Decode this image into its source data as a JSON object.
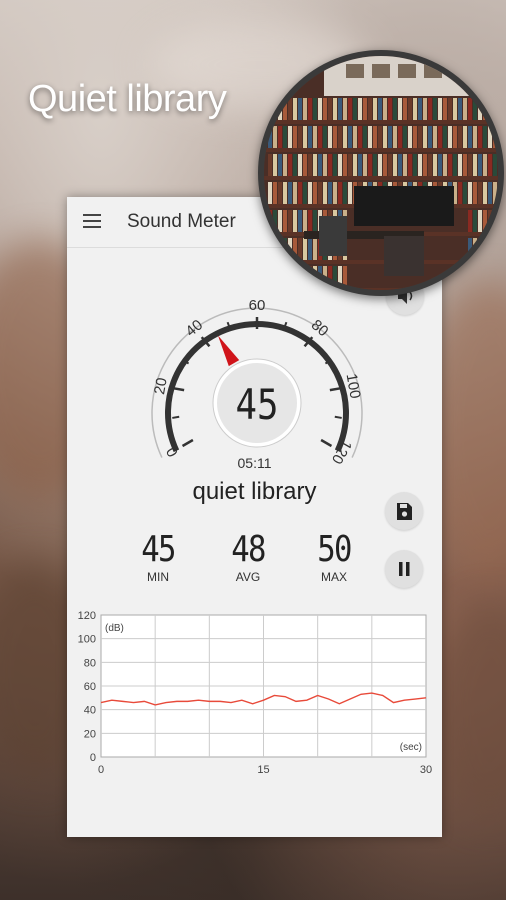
{
  "headline": "Quiet library",
  "app": {
    "title": "Sound Meter",
    "menu_icon": "hamburger-menu-icon"
  },
  "gauge": {
    "ticks": [
      "0",
      "20",
      "40",
      "60",
      "80",
      "100",
      "120"
    ],
    "reading": "45",
    "needle_db": 45,
    "needle_color": "#d0141a"
  },
  "timer": "05:11",
  "environment": "quiet library",
  "stats": {
    "min": {
      "value": "45",
      "label": "MIN"
    },
    "avg": {
      "value": "48",
      "label": "AVG"
    },
    "max": {
      "value": "50",
      "label": "MAX"
    }
  },
  "buttons": {
    "speaker_icon": "speaker-icon",
    "save_icon": "save-icon",
    "pause_icon": "pause-icon"
  },
  "chart_data": {
    "type": "line",
    "ylabel": "(dB)",
    "xlabel": "(sec)",
    "xlim": [
      0,
      30
    ],
    "ylim": [
      0,
      120
    ],
    "x_ticks": [
      "0",
      "15",
      "30"
    ],
    "y_ticks": [
      "0",
      "20",
      "40",
      "60",
      "80",
      "100",
      "120"
    ],
    "grid": true,
    "line_color": "#e84a3a",
    "x": [
      0,
      1,
      2,
      3,
      4,
      5,
      6,
      7,
      8,
      9,
      10,
      11,
      12,
      13,
      14,
      15,
      16,
      17,
      18,
      19,
      20,
      21,
      22,
      23,
      24,
      25,
      26,
      27,
      28,
      29,
      30
    ],
    "values": [
      46,
      48,
      47,
      46,
      47,
      44,
      46,
      47,
      47,
      48,
      47,
      47,
      46,
      48,
      45,
      48,
      52,
      51,
      47,
      48,
      52,
      49,
      45,
      49,
      53,
      54,
      52,
      46,
      48,
      49,
      50
    ]
  }
}
